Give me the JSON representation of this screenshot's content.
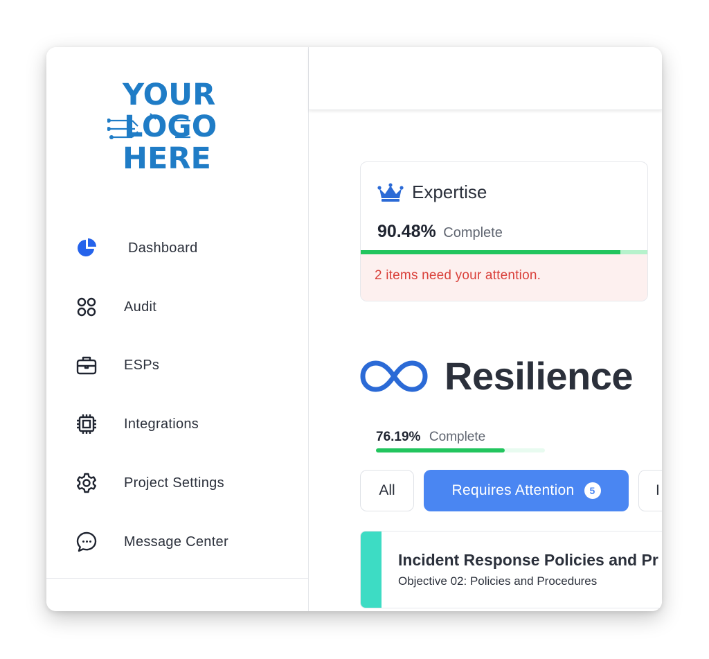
{
  "logo": {
    "line1": "YOUR",
    "line2": "LOGO",
    "line3": "HERE"
  },
  "sidebar": {
    "items": [
      {
        "label": "Dashboard",
        "icon": "pie-chart-icon"
      },
      {
        "label": "Audit",
        "icon": "grid-icon"
      },
      {
        "label": "ESPs",
        "icon": "briefcase-icon"
      },
      {
        "label": "Integrations",
        "icon": "chip-icon"
      },
      {
        "label": "Project Settings",
        "icon": "gear-icon"
      },
      {
        "label": "Message Center",
        "icon": "chat-bubble-icon"
      }
    ]
  },
  "expertise": {
    "title": "Expertise",
    "icon": "crown-icon",
    "percent": "90.48%",
    "percent_word": "Complete",
    "progress": 0.9048,
    "alert": "2 items need your attention."
  },
  "resilience": {
    "title": "Resilience",
    "icon": "infinity-icon",
    "percent": "76.19%",
    "percent_word": "Complete",
    "progress": 0.7619
  },
  "filters": {
    "all": "All",
    "requires_attention": "Requires Attention",
    "requires_attention_count": "5",
    "next_partial": "I"
  },
  "objective": {
    "title": "Incident Response Policies and Pr",
    "subtitle": "Objective 02: Policies and Procedures"
  },
  "colors": {
    "brand_blue": "#1f7cc6",
    "primary_button": "#4a86f2",
    "progress_green": "#22c55e",
    "alert_red": "#d9403a",
    "alert_bg": "#fdf0ef",
    "teal_stripe": "#3ddcc4"
  }
}
